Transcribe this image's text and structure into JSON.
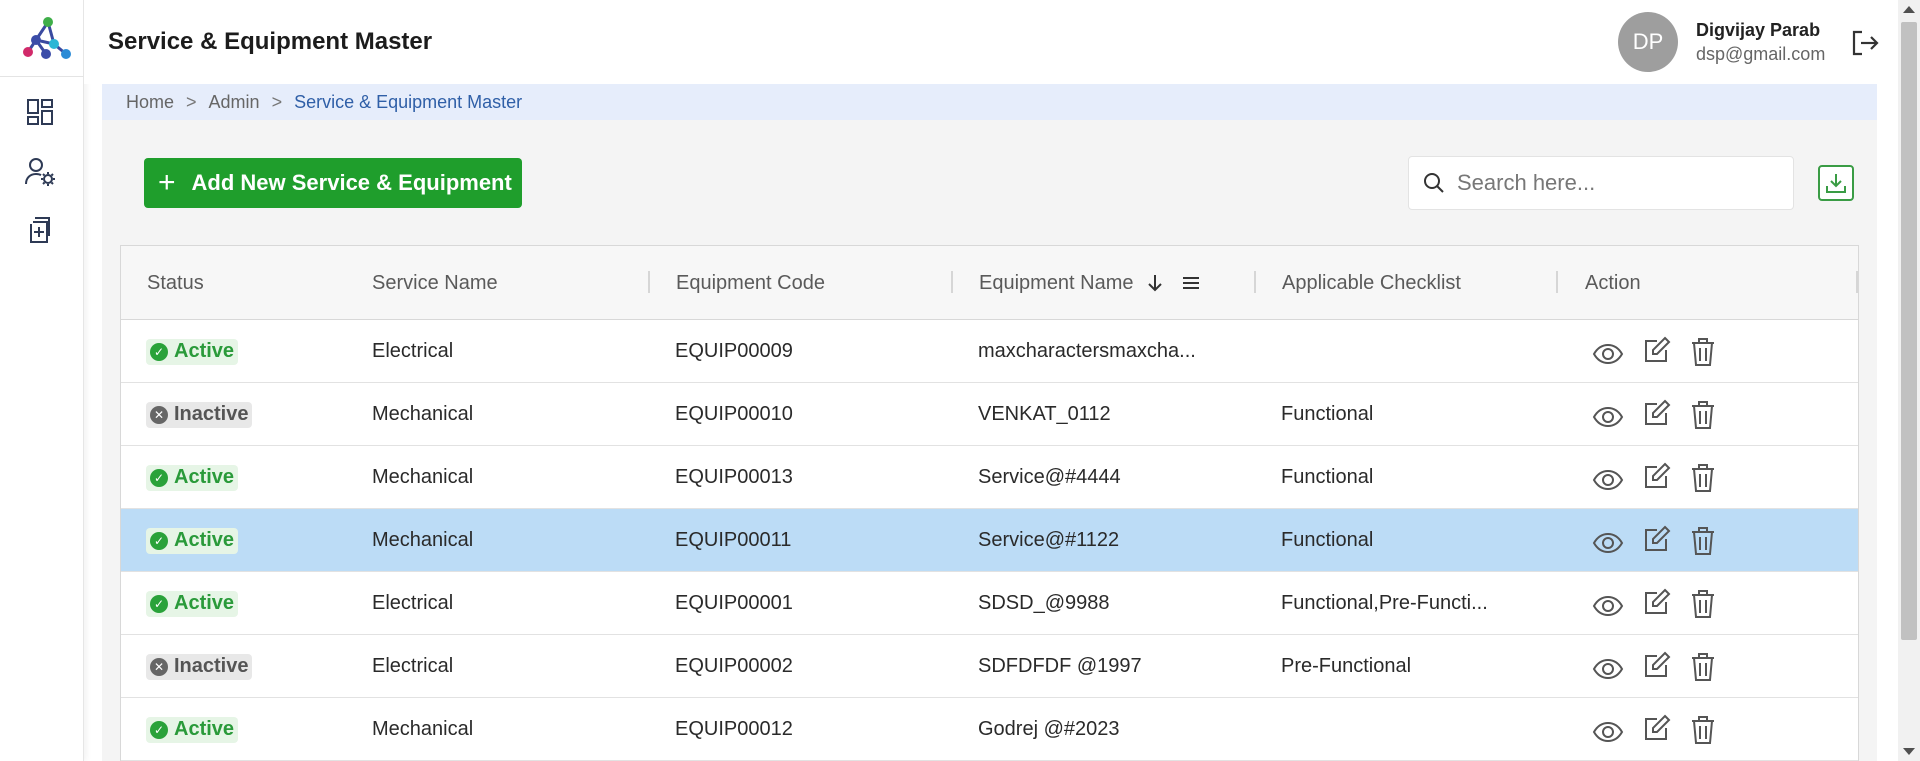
{
  "header": {
    "title": "Service & Equipment Master",
    "user": {
      "initials": "DP",
      "name": "Digvijay Parab",
      "email": "dsp@gmail.com"
    }
  },
  "breadcrumb": {
    "items": [
      "Home",
      "Admin",
      "Service & Equipment Master"
    ],
    "separator": ">"
  },
  "toolbar": {
    "add_label": "Add New Service & Equipment",
    "search_placeholder": "Search here..."
  },
  "colors": {
    "accent_green": "#1f9e2c",
    "selected_row": "#bcdcf6",
    "breadcrumb_bg": "#e6edfb",
    "link_blue": "#2f5fa7"
  },
  "icons": {
    "sidebar": [
      "dashboard-icon",
      "user-settings-icon",
      "add-document-icon"
    ],
    "actions": [
      "eye-icon",
      "edit-icon",
      "trash-icon"
    ]
  },
  "table": {
    "columns": [
      "Status",
      "Service Name",
      "Equipment Code",
      "Equipment Name",
      "Applicable Checklist",
      "Action"
    ],
    "sorted_column": "Equipment Name",
    "sort_direction": "descending",
    "rows": [
      {
        "status": "Active",
        "service": "Electrical",
        "code": "EQUIP00009",
        "name": "maxcharactersmaxcha...",
        "checklist": "",
        "selected": false
      },
      {
        "status": "Inactive",
        "service": "Mechanical",
        "code": "EQUIP00010",
        "name": "VENKAT_0112",
        "checklist": "Functional",
        "selected": false
      },
      {
        "status": "Active",
        "service": "Mechanical",
        "code": "EQUIP00013",
        "name": "Service@#4444",
        "checklist": "Functional",
        "selected": false
      },
      {
        "status": "Active",
        "service": "Mechanical",
        "code": "EQUIP00011",
        "name": "Service@#1122",
        "checklist": "Functional",
        "selected": true
      },
      {
        "status": "Active",
        "service": "Electrical",
        "code": "EQUIP00001",
        "name": "SDSD_@9988",
        "checklist": "Functional,Pre-Functi...",
        "selected": false
      },
      {
        "status": "Inactive",
        "service": "Electrical",
        "code": "EQUIP00002",
        "name": "SDFDFDF @1997",
        "checklist": "Pre-Functional",
        "selected": false
      },
      {
        "status": "Active",
        "service": "Mechanical",
        "code": "EQUIP00012",
        "name": "Godrej @#2023",
        "checklist": "",
        "selected": false
      }
    ]
  }
}
